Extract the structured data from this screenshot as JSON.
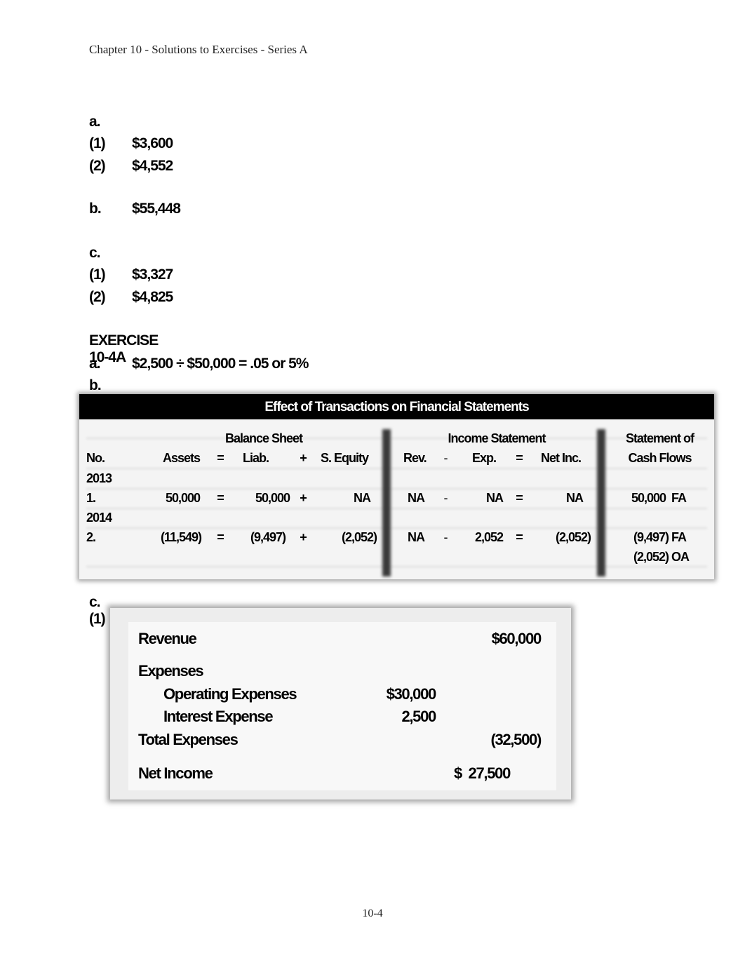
{
  "header": {
    "title": "Chapter 10 - Solutions to Exercises - Series A"
  },
  "prev_exercise": {
    "a": {
      "label": "a.",
      "items": [
        {
          "num": "(1)",
          "value": "$3,600"
        },
        {
          "num": "(2)",
          "value": "$4,552"
        }
      ]
    },
    "b": {
      "label": "b.",
      "value": "$55,448"
    },
    "c": {
      "label": "c.",
      "items": [
        {
          "num": "(1)",
          "value": "$3,327"
        },
        {
          "num": "(2)",
          "value": "$4,825"
        }
      ]
    }
  },
  "exercise": {
    "title": "EXERCISE 10-4A",
    "a": {
      "label": "a.",
      "value": "$2,500 ÷ $50,000 = .05 or 5%"
    },
    "b": {
      "label": "b."
    },
    "c": {
      "label": "c. (1)"
    }
  },
  "effects_table": {
    "title": "Effect of Transactions on Financial Statements",
    "groups": {
      "balance_sheet": "Balance Sheet",
      "income_statement": "Income Statement",
      "cash_flows_1": "Statement of",
      "cash_flows_2": "Cash Flows"
    },
    "columns": {
      "no": "No.",
      "assets": "Assets",
      "eq1": "=",
      "liab": "Liab.",
      "plus": "+",
      "equity": "S. Equity",
      "rev": "Rev.",
      "minus": "-",
      "exp": "Exp.",
      "eq2": "=",
      "net": "Net Inc."
    },
    "rows": [
      {
        "year": "2013"
      },
      {
        "no": "1.",
        "assets": "50,000",
        "eq1": "=",
        "liab": "50,000",
        "plus": "+",
        "equity": "NA",
        "rev": "NA",
        "minus": "-",
        "exp": "NA",
        "eq2": "=",
        "net": "NA",
        "cash": [
          "50,000  FA"
        ]
      },
      {
        "year": "2014"
      },
      {
        "no": "2.",
        "assets": "(11,549)",
        "eq1": "=",
        "liab": "(9,497)",
        "plus": "+",
        "equity": "(2,052)",
        "rev": "NA",
        "minus": "-",
        "exp": "2,052",
        "eq2": "=",
        "net": "(2,052)",
        "cash": [
          "(9,497) FA",
          "(2,052) OA"
        ]
      }
    ]
  },
  "income_statement": {
    "rows": [
      {
        "label": "Revenue",
        "col1": "",
        "col2": "$60,000"
      },
      {
        "label": "Expenses",
        "col1": "",
        "col2": ""
      },
      {
        "label": "Operating Expenses",
        "col1": "$30,000",
        "col2": ""
      },
      {
        "label": "Interest Expense",
        "col1": "2,500",
        "col2": ""
      },
      {
        "label": "Total Expenses",
        "col1": "",
        "col2": "(32,500)"
      },
      {
        "label": "Net Income",
        "col1": "",
        "col2": "$  27,500"
      }
    ]
  },
  "footer": {
    "page": "10-4"
  }
}
